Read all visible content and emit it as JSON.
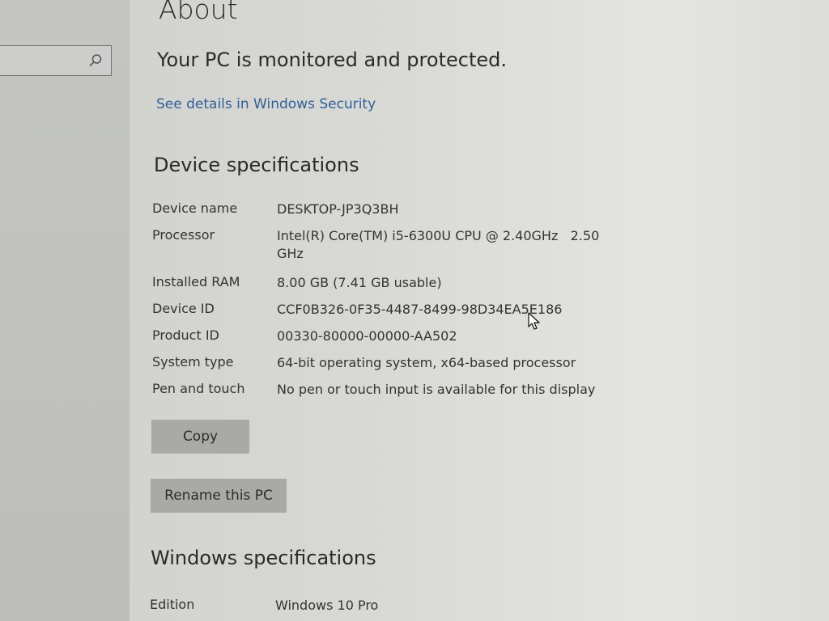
{
  "page": {
    "title": "About",
    "protection_status": "Your PC is monitored and protected.",
    "security_link": "See details in Windows Security"
  },
  "device_specifications": {
    "heading": "Device specifications",
    "rows": [
      {
        "label": "Device name",
        "value": "DESKTOP-JP3Q3BH"
      },
      {
        "label": "Processor",
        "value": "Intel(R) Core(TM) i5-6300U CPU @ 2.40GHz   2.50 GHz"
      },
      {
        "label": "Installed RAM",
        "value": "8.00 GB (7.41 GB usable)"
      },
      {
        "label": "Device ID",
        "value": "CCF0B326-0F35-4487-8499-98D34EA5E186"
      },
      {
        "label": "Product ID",
        "value": "00330-80000-00000-AA502"
      },
      {
        "label": "System type",
        "value": "64-bit operating system, x64-based processor"
      },
      {
        "label": "Pen and touch",
        "value": "No pen or touch input is available for this display"
      }
    ],
    "copy_button": "Copy",
    "rename_button": "Rename this PC"
  },
  "windows_specifications": {
    "heading": "Windows specifications",
    "rows": [
      {
        "label": "Edition",
        "value": "Windows 10 Pro"
      }
    ]
  },
  "icons": {
    "search": "search-icon",
    "cursor": "mouse-pointer-icon"
  },
  "colors": {
    "link": "#2f5f9a",
    "button_bg": "#a9aaa6",
    "sidebar_bg": "#c4c5c1"
  }
}
